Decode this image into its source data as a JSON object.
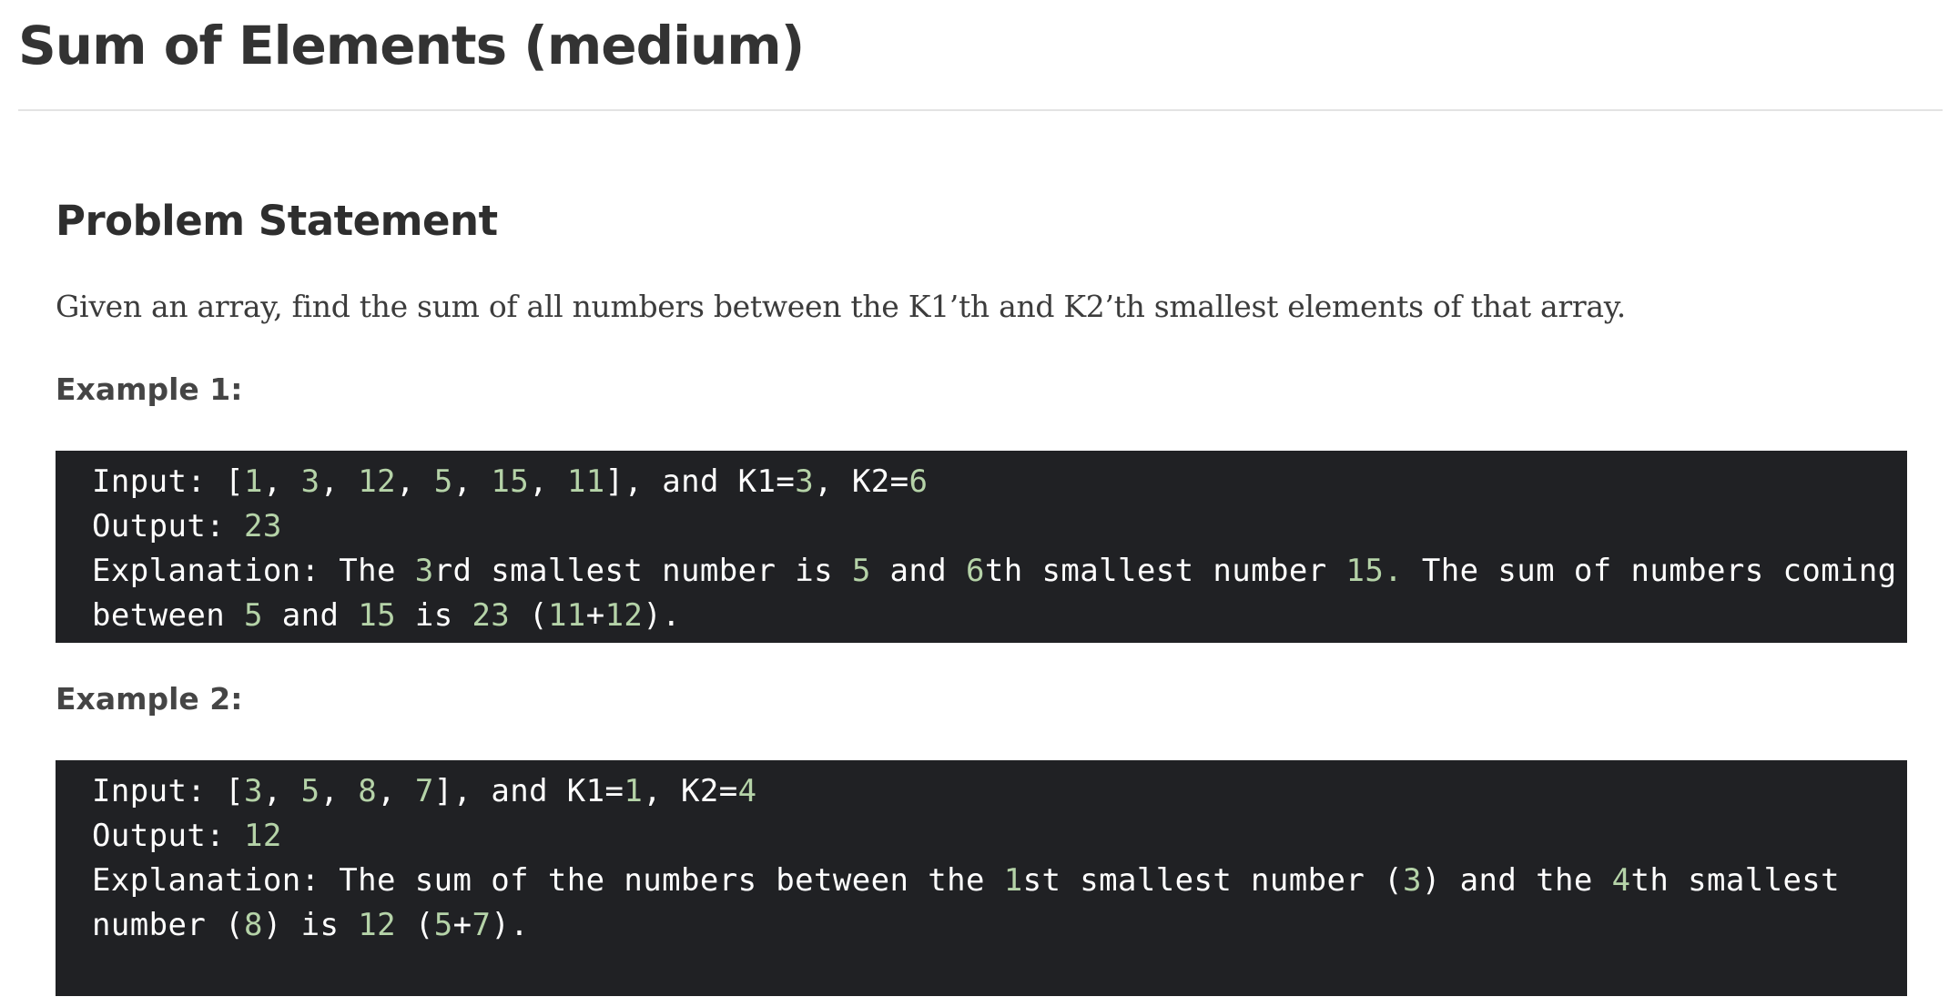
{
  "page": {
    "title": "Sum of Elements (medium)"
  },
  "problem": {
    "heading": "Problem Statement",
    "statement": "Given an array, find the sum of all numbers between the K1’th and K2’th smallest elements of that array."
  },
  "examples": [
    {
      "heading": "Example 1:",
      "lines": [
        [
          {
            "t": "Input: [",
            "n": false
          },
          {
            "t": "1",
            "n": true
          },
          {
            "t": ", ",
            "n": false
          },
          {
            "t": "3",
            "n": true
          },
          {
            "t": ", ",
            "n": false
          },
          {
            "t": "12",
            "n": true
          },
          {
            "t": ", ",
            "n": false
          },
          {
            "t": "5",
            "n": true
          },
          {
            "t": ", ",
            "n": false
          },
          {
            "t": "15",
            "n": true
          },
          {
            "t": ", ",
            "n": false
          },
          {
            "t": "11",
            "n": true
          },
          {
            "t": "], and K1=",
            "n": false
          },
          {
            "t": "3",
            "n": true
          },
          {
            "t": ", K2=",
            "n": false
          },
          {
            "t": "6",
            "n": true
          }
        ],
        [
          {
            "t": "Output: ",
            "n": false
          },
          {
            "t": "23",
            "n": true
          }
        ],
        [
          {
            "t": "Explanation: The ",
            "n": false
          },
          {
            "t": "3",
            "n": true
          },
          {
            "t": "rd smallest number is ",
            "n": false
          },
          {
            "t": "5",
            "n": true
          },
          {
            "t": " and ",
            "n": false
          },
          {
            "t": "6",
            "n": true
          },
          {
            "t": "th smallest number ",
            "n": false
          },
          {
            "t": "15.",
            "n": true
          },
          {
            "t": " The sum of numbers coming",
            "n": false
          }
        ],
        [
          {
            "t": "between ",
            "n": false
          },
          {
            "t": "5",
            "n": true
          },
          {
            "t": " and ",
            "n": false
          },
          {
            "t": "15",
            "n": true
          },
          {
            "t": " is ",
            "n": false
          },
          {
            "t": "23",
            "n": true
          },
          {
            "t": " (",
            "n": false
          },
          {
            "t": "11",
            "n": true
          },
          {
            "t": "+",
            "n": false
          },
          {
            "t": "12",
            "n": true
          },
          {
            "t": ").",
            "n": false
          }
        ]
      ]
    },
    {
      "heading": "Example 2:",
      "lines": [
        [
          {
            "t": "Input: [",
            "n": false
          },
          {
            "t": "3",
            "n": true
          },
          {
            "t": ", ",
            "n": false
          },
          {
            "t": "5",
            "n": true
          },
          {
            "t": ", ",
            "n": false
          },
          {
            "t": "8",
            "n": true
          },
          {
            "t": ", ",
            "n": false
          },
          {
            "t": "7",
            "n": true
          },
          {
            "t": "], and K1=",
            "n": false
          },
          {
            "t": "1",
            "n": true
          },
          {
            "t": ", K2=",
            "n": false
          },
          {
            "t": "4",
            "n": true
          }
        ],
        [
          {
            "t": "Output: ",
            "n": false
          },
          {
            "t": "12",
            "n": true
          }
        ],
        [
          {
            "t": "Explanation: The sum of the numbers between the ",
            "n": false
          },
          {
            "t": "1",
            "n": true
          },
          {
            "t": "st smallest number (",
            "n": false
          },
          {
            "t": "3",
            "n": true
          },
          {
            "t": ") and the ",
            "n": false
          },
          {
            "t": "4",
            "n": true
          },
          {
            "t": "th smallest",
            "n": false
          }
        ],
        [
          {
            "t": "number (",
            "n": false
          },
          {
            "t": "8",
            "n": true
          },
          {
            "t": ") is ",
            "n": false
          },
          {
            "t": "12",
            "n": true
          },
          {
            "t": " (",
            "n": false
          },
          {
            "t": "5",
            "n": true
          },
          {
            "t": "+",
            "n": false
          },
          {
            "t": "7",
            "n": true
          },
          {
            "t": ").",
            "n": false
          }
        ]
      ]
    }
  ]
}
